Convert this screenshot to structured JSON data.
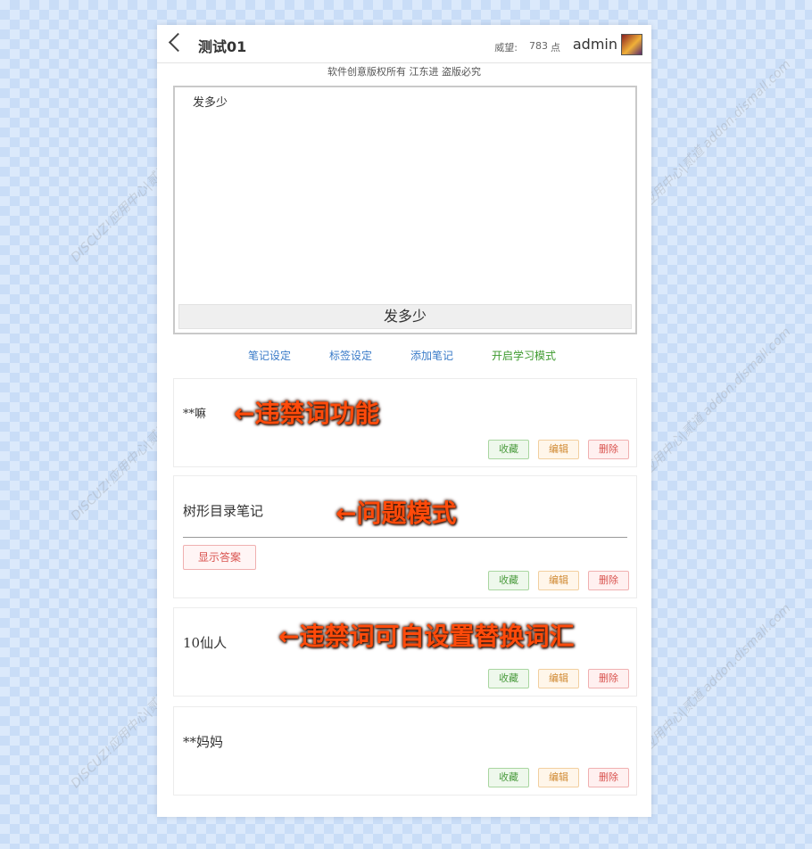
{
  "header": {
    "back_icon": "chevron-left-icon",
    "title": "测试01",
    "prestige_label": "威望:",
    "prestige_value": "783",
    "prestige_unit": "点",
    "username": "admin"
  },
  "copyright": "软件创意版权所有 江东进 盗版必究",
  "editor": {
    "text": "发多少",
    "submit_label": "发多少"
  },
  "toolbar": {
    "note_settings": "笔记设定",
    "tag_settings": "标签设定",
    "add_note": "添加笔记",
    "study_mode": "开启学习模式"
  },
  "notes": [
    {
      "text": "**嘛",
      "fav": "收藏",
      "edit": "编辑",
      "delete": "删除"
    },
    {
      "text": "树形目录笔记",
      "show_answer": "显示答案",
      "fav": "收藏",
      "edit": "编辑",
      "delete": "删除"
    },
    {
      "text": "10仙人",
      "fav": "收藏",
      "edit": "编辑",
      "delete": "删除"
    },
    {
      "text": "**妈妈",
      "fav": "收藏",
      "edit": "编辑",
      "delete": "删除"
    }
  ],
  "annotations": {
    "a1": "←违禁词功能",
    "a2": "←问题模式",
    "a3": "←违禁词可自设置替换词汇"
  },
  "watermark": {
    "line1": "DISCUZ!应用中心|贰道",
    "line2": "addon.dismall.com"
  },
  "colors": {
    "accent_blue": "#3a7bc8",
    "accent_green": "#3d9a2e",
    "annotation_red": "#ff4a0a"
  }
}
